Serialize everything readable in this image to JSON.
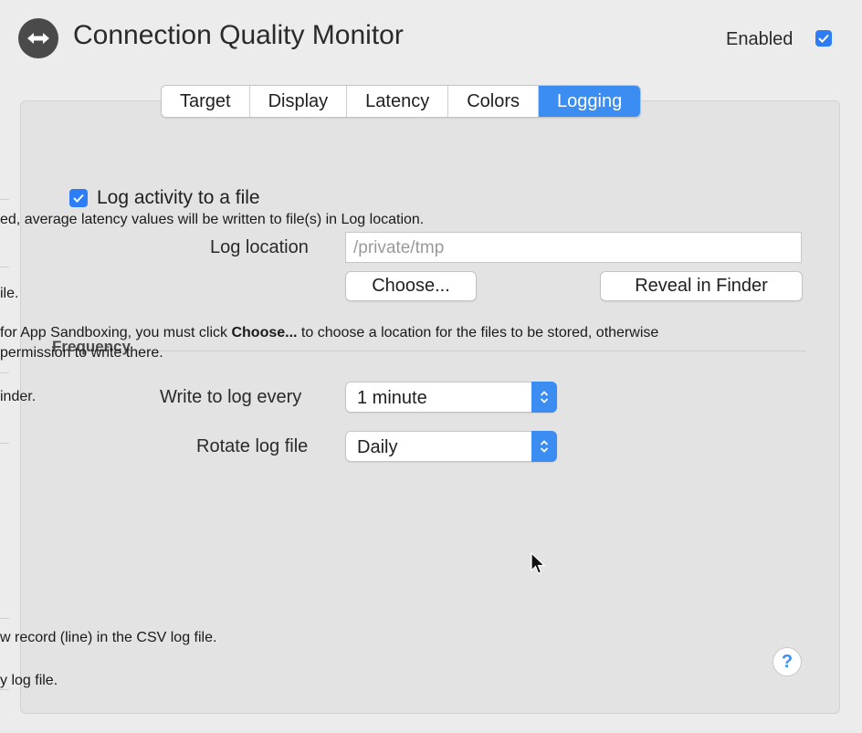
{
  "header": {
    "title": "Connection Quality Monitor",
    "enabled_label": "Enabled",
    "enabled": true
  },
  "tabs": [
    {
      "label": "Target"
    },
    {
      "label": "Display"
    },
    {
      "label": "Latency"
    },
    {
      "label": "Colors"
    },
    {
      "label": "Logging",
      "active": true
    }
  ],
  "logging": {
    "log_activity_label": "Log activity to a file",
    "log_activity_checked": true,
    "log_location_label": "Log location",
    "log_location_placeholder": "/private/tmp",
    "choose_button": "Choose...",
    "reveal_button": "Reveal in Finder"
  },
  "frequency": {
    "section_title": "Frequency",
    "write_label": "Write to log every",
    "write_value": "1 minute",
    "rotate_label": "Rotate log file",
    "rotate_value": "Daily"
  },
  "help_label": "?",
  "background_fragments": {
    "f1": "ed, average latency values will be written to file(s) in Log location.",
    "f2": "ile.",
    "f3a": " for App Sandboxing, you must click ",
    "f3b": "Choose...",
    "f3c": " to choose a location for the files to be stored, otherwise",
    "f4": " permission to write there.",
    "f5": "inder.",
    "f6": "w record (line) in the CSV log file.",
    "f7": "y log file."
  },
  "colors": {
    "accent": "#3b8df2",
    "window_bg": "#ececec",
    "panel_bg": "#e3e3e3"
  }
}
